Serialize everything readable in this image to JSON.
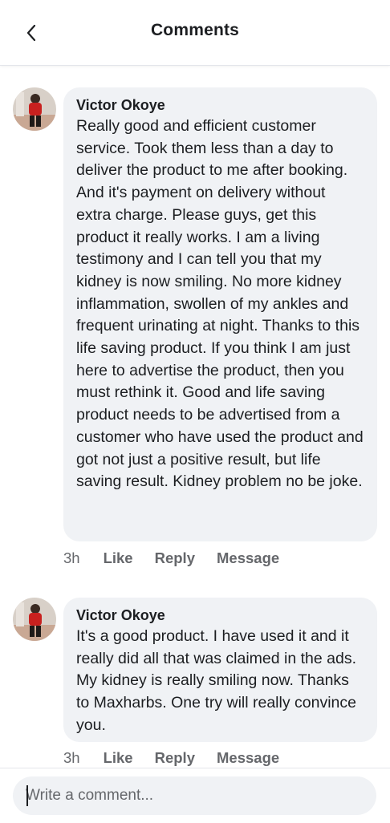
{
  "header": {
    "title": "Comments",
    "back_icon": "chevron-left-icon"
  },
  "comments": [
    {
      "author": "Victor Okoye",
      "text": "Really good and efficient customer service. Took them less than a day to deliver the product to me after booking. And it's payment on delivery without extra charge. Please guys, get this product it really works. I am a living testimony and I can tell you that my kidney is now smiling. No more kidney inflammation, swollen of my ankles and frequent urinating at night. Thanks to this life saving product. If you think I am just here to advertise the product, then you must rethink it. Good and life saving product needs to be advertised from a customer who have used the product and got not just a positive result, but life saving result. Kidney problem no be joke.",
      "time": "3h",
      "like_label": "Like",
      "reply_label": "Reply",
      "message_label": "Message"
    },
    {
      "author": "Victor Okoye",
      "text": "It's a good product. I have used it and it really did all that was claimed in the ads. My kidney is really smiling now. Thanks to Maxharbs. One try will really convince you.",
      "time": "3h",
      "like_label": "Like",
      "reply_label": "Reply",
      "message_label": "Message"
    }
  ],
  "composer": {
    "placeholder": "Write a comment...",
    "value": ""
  },
  "colors": {
    "bubble": "#f0f2f5",
    "secondary_text": "#65676b",
    "primary_text": "#1c1e21"
  }
}
